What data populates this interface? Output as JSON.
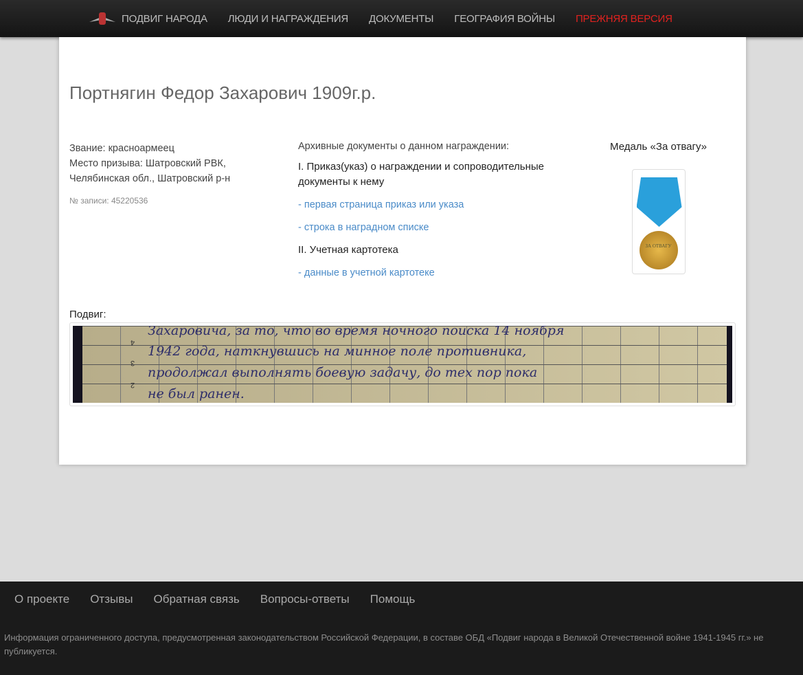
{
  "nav": {
    "items": [
      "ПОДВИГ НАРОДА",
      "ЛЮДИ И НАГРАЖДЕНИЯ",
      "ДОКУМЕНТЫ",
      "ГЕОГРАФИЯ ВОЙНЫ",
      "ПРЕЖНЯЯ ВЕРСИЯ"
    ]
  },
  "person": {
    "title": "Портнягин Федор Захарович 1909г.р.",
    "rank": "Звание: красноармеец",
    "place1": "Место призыва: Шатровский РВК,",
    "place2": "Челябинская обл., Шатровский р-н",
    "record": "№ записи: 45220536"
  },
  "docs": {
    "heading": "Архивные документы о данном награждении:",
    "section1": "I. Приказ(указ) о награждении и сопроводительные документы к нему",
    "link1": "- первая страница приказ или указа",
    "link2": "- строка в наградном списке",
    "section2": "II. Учетная картотека",
    "link3": "- данные в учетной картотеке"
  },
  "award": {
    "title": "Медаль «За отвагу»",
    "medal_text": "ЗА ОТВАГУ"
  },
  "feat": {
    "label": "Подвиг:",
    "lines": [
      "Захаровича, за то, что во время ночного поиска 14 ноября",
      "1942 года, наткнувшись на минное поле противника,",
      "продолжал выполнять боевую задачу, до тех пор пока",
      "не был ранен."
    ],
    "row_numbers": [
      "4",
      "3",
      "2"
    ]
  },
  "footer": {
    "links": [
      "О проекте",
      "Отзывы",
      "Обратная связь",
      "Вопросы-ответы",
      "Помощь"
    ],
    "notice": "Информация ограниченного доступа, предусмотренная законодательством Российской Федерации, в составе ОБД «Подвиг народа в Великой Отечественной войне 1941-1945 гг.» не публикуется."
  }
}
